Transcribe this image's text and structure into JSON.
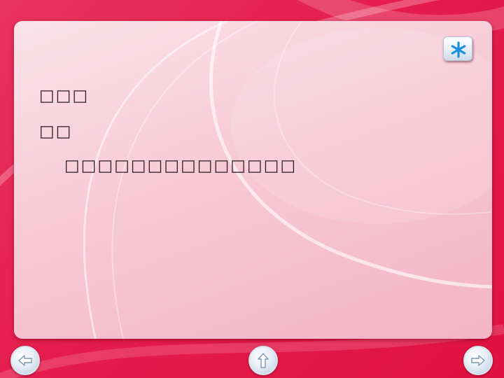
{
  "slide": {
    "lines": [
      "□□□",
      "□□",
      "□□□□□□□□□□□□□□"
    ]
  },
  "controls": {
    "star_icon": "asterisk-icon",
    "prev_icon": "arrow-left-icon",
    "home_icon": "arrow-up-icon",
    "next_icon": "arrow-right-icon"
  },
  "colors": {
    "background": "#e51d4d",
    "card": "#f7c9d6",
    "asterisk": "#1a8fe0"
  }
}
